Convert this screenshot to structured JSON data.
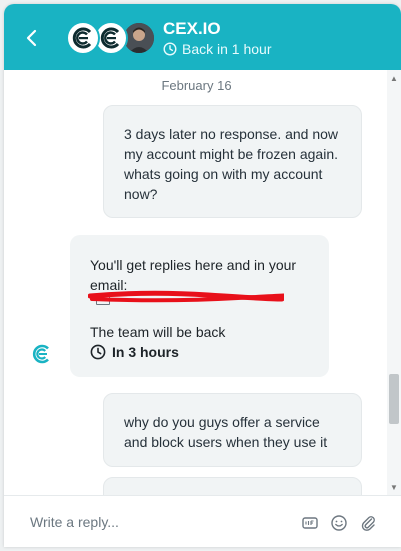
{
  "header": {
    "title": "CEX.IO",
    "status": "Back in 1 hour"
  },
  "conversation": {
    "date": "February 16",
    "messages": [
      {
        "from": "user",
        "text": "3 days later no response. and now my account might be frozen again. whats going on with my account now?"
      },
      {
        "from": "bot",
        "line1": "You'll get replies here and in your email:",
        "team": "The team will be back",
        "eta": "In 3 hours"
      },
      {
        "from": "user",
        "text": "why do you guys offer a service and block users when they use it"
      }
    ]
  },
  "composer": {
    "placeholder": "Write a reply..."
  },
  "colors": {
    "brand": "#19b3c3",
    "redaction": "#e8101a"
  },
  "icons": [
    "back-chevron-icon",
    "clock-icon",
    "cexio-logo-icon",
    "gif-icon",
    "emoji-icon",
    "paperclip-icon"
  ]
}
